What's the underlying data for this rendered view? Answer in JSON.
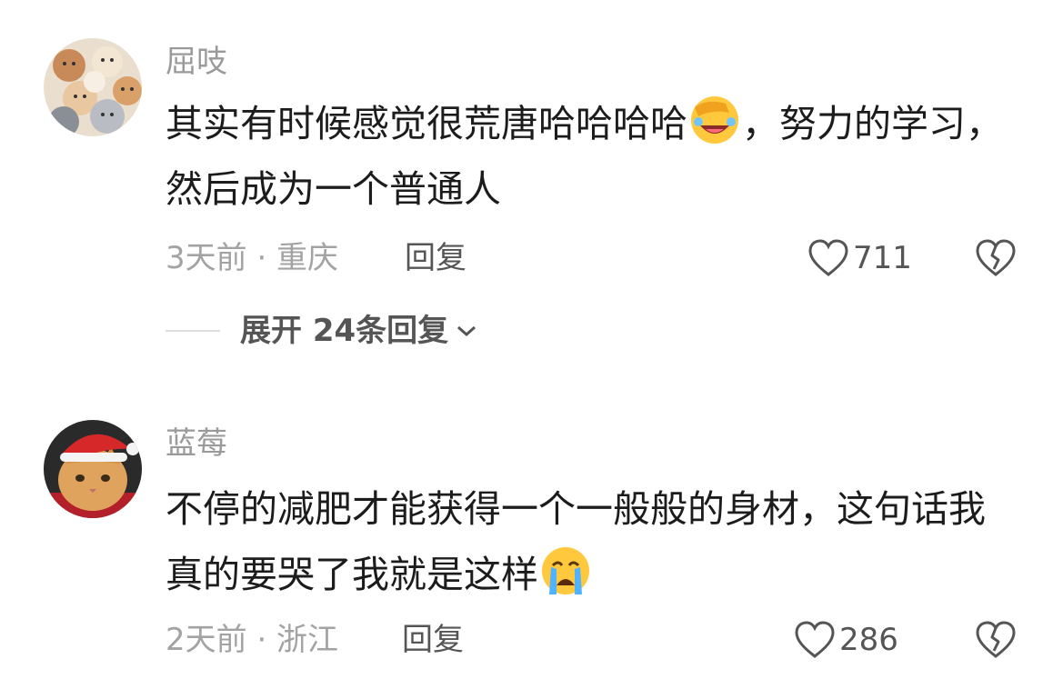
{
  "comments": [
    {
      "username": "屈吱",
      "text_before_emoji": "其实有时候感觉很荒唐哈哈哈哈",
      "emoji": "facepalm-laugh-emoji",
      "text_after_emoji": "，努力的学习，然后成为一个普通人",
      "meta": "3天前 · 重庆",
      "reply_label": "回复",
      "likes": "711"
    },
    {
      "username": "蓝莓",
      "text_before_emoji": "不停的减肥才能获得一个一般般的身材，这句话我真的要哭了我就是这样",
      "emoji": "crying-emoji",
      "text_after_emoji": "",
      "meta": "2天前 · 浙江",
      "reply_label": "回复",
      "likes": "286"
    }
  ],
  "expand_replies": "展开 24条回复",
  "icons": {
    "like": "heart-outline-icon",
    "dislike": "broken-heart-icon",
    "expand": "chevron-down-icon"
  },
  "colors": {
    "username": "#9a9a9a",
    "text": "#1c1c1c",
    "meta": "#a3a3a3",
    "action": "#555555"
  }
}
